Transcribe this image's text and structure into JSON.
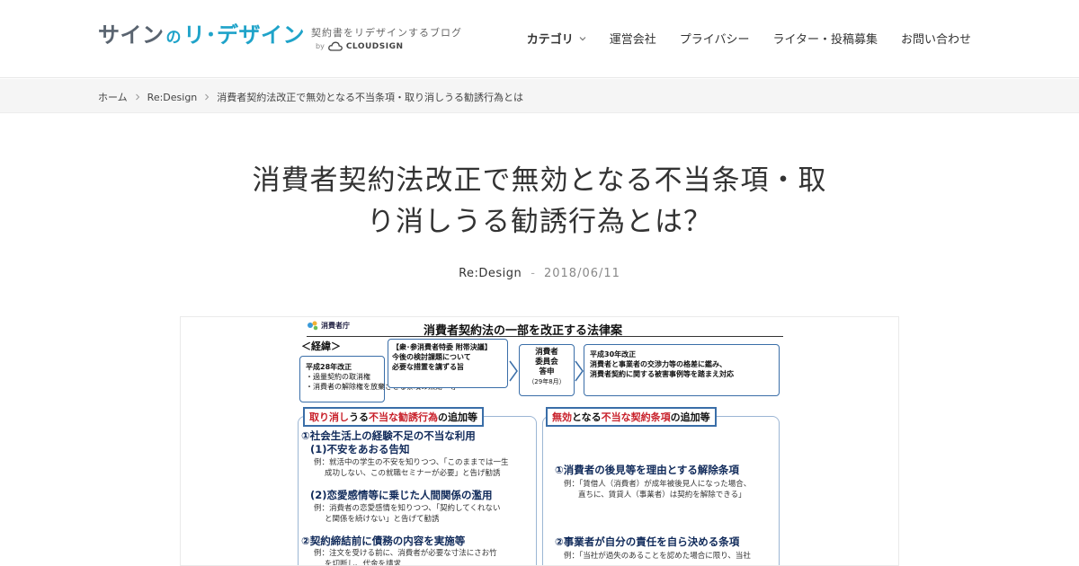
{
  "header": {
    "logo": {
      "part1": "サイン",
      "part_no": "の",
      "part2": "リ･デザイン",
      "tagline": "契約書をリデザインするブログ",
      "by": "by",
      "cloudsign": "CLOUDSIGN"
    },
    "nav": [
      {
        "label": "カテゴリ",
        "active": true
      },
      {
        "label": "運営会社",
        "active": false
      },
      {
        "label": "プライバシー",
        "active": false
      },
      {
        "label": "ライター・投稿募集",
        "active": false
      },
      {
        "label": "お問い合わせ",
        "active": false
      }
    ]
  },
  "breadcrumb": {
    "home": "ホーム",
    "category": "Re:Design",
    "current": "消費者契約法改正で無効となる不当条項・取り消しうる勧誘行為とは"
  },
  "article": {
    "title": "消費者契約法改正で無効となる不当条項・取り消しうる勧誘行為とは？",
    "category": "Re:Design",
    "separator": "-",
    "date": "2018/06/11"
  },
  "slide": {
    "agency": "消費者庁",
    "title": "消費者契約法の一部を改正する法律案",
    "keii": "＜経緯＞",
    "box1": [
      "平成28年改正",
      "・過量契約の取消権",
      "・消費者の解除権を放棄させる条項の無効　等"
    ],
    "box2": [
      "【衆･参消費者特委 附帯決議】",
      "今後の検討課題について",
      "必要な措置を講ずる旨"
    ],
    "box3": [
      "消費者",
      "委員会",
      "答申",
      "（29年8月）"
    ],
    "box4": [
      "平成30年改正",
      "消費者と事業者の交渉力等の格差に鑑み、",
      "消費者契約に関する被害事例等を踏まえ対応"
    ],
    "head_left": {
      "pre": "取り消し",
      "mid": "うる",
      "red": "不当な勧誘行為",
      "post": "の追加等"
    },
    "head_right": {
      "red1": "無効",
      "mid": "となる",
      "red2": "不当な契約条項",
      "post": "の追加等"
    },
    "left_items": [
      {
        "head": "①社会生活上の経験不足の不当な利用",
        "sub": "(1)不安をあおる告知",
        "body": [
          "例：就活中の学生の不安を知りつつ、「このままでは一生",
          "成功しない、この就職セミナーが必要」と告げ勧誘"
        ]
      },
      {
        "head": "(2)恋愛感情等に乗じた人間関係の濫用",
        "body": [
          "例：消費者の恋愛感情を知りつつ、「契約してくれない",
          "と関係を続けない」と告げて勧誘"
        ]
      },
      {
        "head": "②契約締結前に債務の内容を実施等",
        "body": [
          "例：注文を受ける前に、消費者が必要な寸法にさお竹",
          "を切断し、代金を請求"
        ]
      }
    ],
    "right_items": [
      {
        "head": "①消費者の後見等を理由とする解除条項",
        "body": [
          "例：「賃借人（消費者）が成年被後見人になった場合、",
          "直ちに、賃貸人（事業者）は契約を解除できる」"
        ]
      },
      {
        "head": "②事業者が自分の責任を自ら決める条項",
        "body": [
          "例：「当社が過失のあることを認めた場合に限り、当社"
        ]
      }
    ]
  },
  "colors": {
    "brand_blue": "#1fa3c9",
    "logo_gray": "#5a6470",
    "slide_border": "#3a6ea8",
    "slide_red": "#c8202a"
  }
}
